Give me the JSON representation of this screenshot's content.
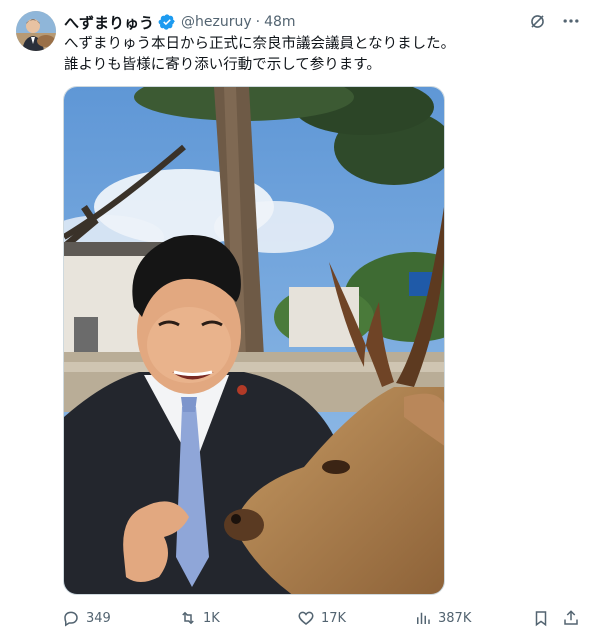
{
  "author": {
    "display_name": "へずまりゅう",
    "handle": "@hezuruy",
    "separator": "·",
    "time": "48m",
    "verified": true,
    "verified_color": "#1d9bf0"
  },
  "tweet": {
    "line1": "へずまりゅう本日から正式に奈良市議会議員となりました。",
    "line2": "誰よりも皆様に寄り添い行動で示して参ります。"
  },
  "media": {
    "kind": "photo"
  },
  "actions": {
    "replies": "349",
    "retweets": "1K",
    "likes": "17K",
    "views": "387K"
  },
  "icons": {
    "grok": "grok-icon",
    "more": "more-icon",
    "reply": "reply-icon",
    "retweet": "retweet-icon",
    "like": "heart-icon",
    "views": "views-icon",
    "bookmark": "bookmark-icon",
    "share": "share-icon"
  },
  "colors": {
    "text": "#0f1419",
    "muted": "#536471",
    "accent": "#1d9bf0"
  }
}
